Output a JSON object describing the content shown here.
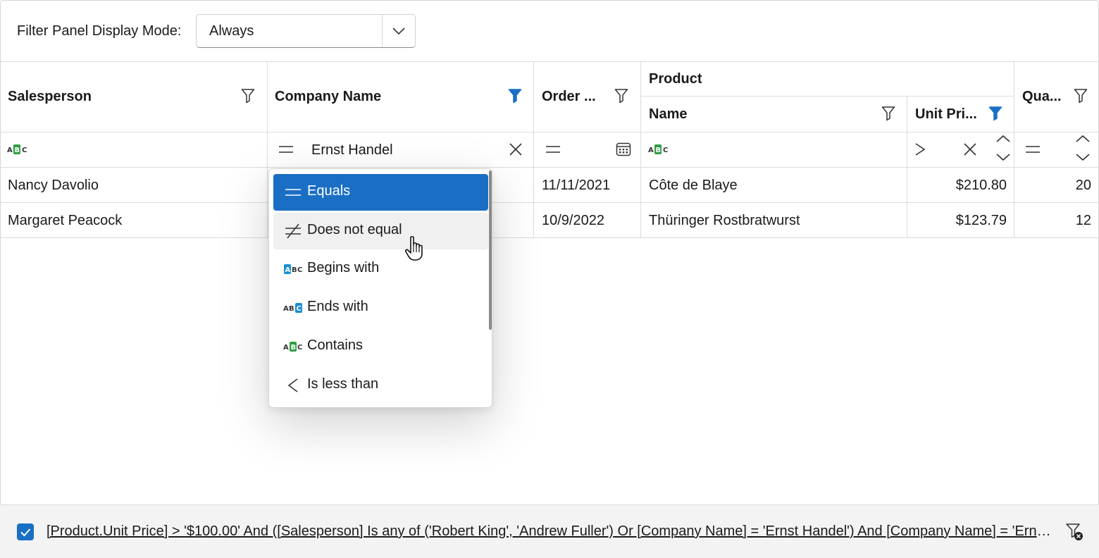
{
  "toolbar": {
    "label": "Filter Panel Display Mode:",
    "mode_value": "Always"
  },
  "columns": {
    "salesperson": "Salesperson",
    "company": "Company Name",
    "order": "Order ...",
    "product_band": "Product",
    "name": "Name",
    "unit_price": "Unit Pri...",
    "quantity": "Qua..."
  },
  "filter_row": {
    "company_value": "Ernst Handel"
  },
  "rows": [
    {
      "salesperson": "Nancy Davolio",
      "order": "11/11/2021",
      "name": "Côte de Blaye",
      "unit_price": "$210.80",
      "quantity": "20"
    },
    {
      "salesperson": "Margaret Peacock",
      "order": "10/9/2022",
      "name": "Thüringer Rostbratwurst",
      "unit_price": "$123.79",
      "quantity": "12"
    }
  ],
  "dropdown": {
    "items": [
      {
        "label": "Equals",
        "icon": "equals-icon"
      },
      {
        "label": "Does not equal",
        "icon": "not-equal-icon"
      },
      {
        "label": "Begins with",
        "icon": "begins-with-icon"
      },
      {
        "label": "Ends with",
        "icon": "ends-with-icon"
      },
      {
        "label": "Contains",
        "icon": "contains-icon"
      },
      {
        "label": "Is less than",
        "icon": "less-than-icon"
      }
    ],
    "selected_index": 0,
    "hovered_index": 1
  },
  "filter_panel": {
    "enabled": true,
    "expression": "[Product.Unit Price] > '$100.00' And ([Salesperson] Is any of ('Robert King', 'Andrew Fuller') Or [Company Name] = 'Ernst Handel') And [Company Name] = 'Ernst Handel'"
  },
  "colors": {
    "accent": "#1a6fc4",
    "abc_green": "#2e9e45",
    "abc_blue": "#1a8fd6"
  }
}
